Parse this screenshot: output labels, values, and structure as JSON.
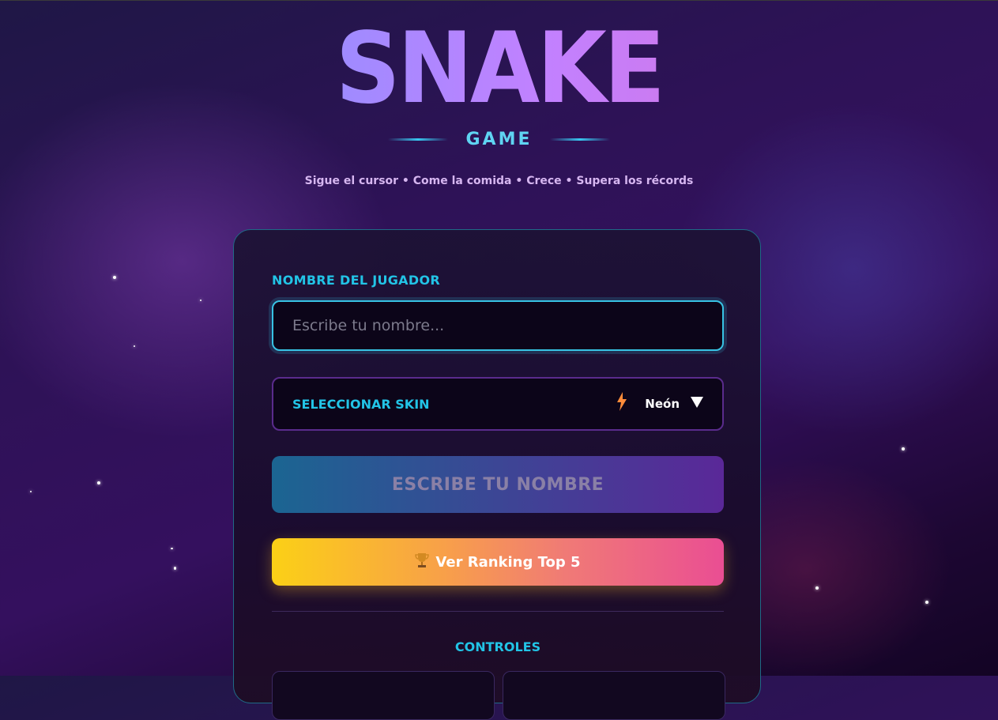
{
  "header": {
    "title": "SNAKE",
    "subtitle": "GAME",
    "tagline": "Sigue el cursor • Come la comida • Crece • Supera los récords"
  },
  "form": {
    "name_label": "NOMBRE DEL JUGADOR",
    "name_placeholder": "Escribe tu nombre...",
    "name_value": "",
    "skin_label": "SELECCIONAR SKIN",
    "skin_icon": "lightning-bolt-icon",
    "skin_value": "Neón",
    "play_button": "ESCRIBE TU NOMBRE",
    "ranking_button": "Ver Ranking Top 5",
    "ranking_icon": "trophy-icon",
    "controls_title": "CONTROLES"
  },
  "colors": {
    "accent_cyan": "#22c4e6",
    "title_gradient_start": "#5eb8ff",
    "title_gradient_end": "#e06bd0",
    "ranking_gradient_start": "#fbd016",
    "ranking_gradient_end": "#ea4e93"
  }
}
